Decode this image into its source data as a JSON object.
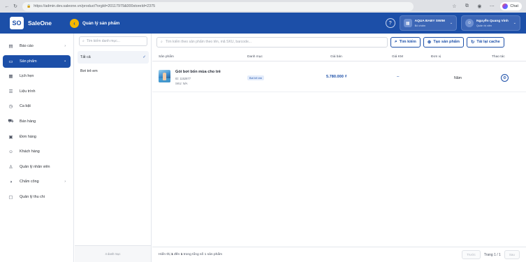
{
  "browser": {
    "url": "https://admin.dev.saleone.vn/product?orgId=20117979&000storeId=2375",
    "chat_label": "Chat"
  },
  "header": {
    "logo_mark": "SO",
    "logo_text": "SaleOne",
    "page_title": "Quản lý sản phẩm",
    "store": {
      "name": "AQUA BABY SWIM",
      "sub": "Bố chấm"
    },
    "user": {
      "name": "Nguyễn Quang Vinh",
      "role": "Quản trị viên"
    }
  },
  "sidebar": {
    "items": [
      {
        "label": "Báo cáo",
        "icon": "report-icon",
        "glyph": "▤",
        "chevron": true,
        "active": false
      },
      {
        "label": "Sản phẩm",
        "icon": "monitor-icon",
        "glyph": "▭",
        "chevron": true,
        "active": true
      },
      {
        "label": "Lịch hẹn",
        "icon": "calendar-icon",
        "glyph": "▦",
        "chevron": false,
        "active": false
      },
      {
        "label": "Liệu trình",
        "icon": "list-icon",
        "glyph": "☰",
        "chevron": false,
        "active": false
      },
      {
        "label": "Ca bật",
        "icon": "clock-icon",
        "glyph": "◷",
        "chevron": false,
        "active": false
      },
      {
        "label": "Bán hàng",
        "icon": "cart-icon",
        "glyph": "⛟",
        "chevron": false,
        "active": false
      },
      {
        "label": "Đơn hàng",
        "icon": "box-icon",
        "glyph": "▣",
        "chevron": false,
        "active": false
      },
      {
        "label": "Khách hàng",
        "icon": "users-icon",
        "glyph": "☺",
        "chevron": false,
        "active": false
      },
      {
        "label": "Quản lý nhân viên",
        "icon": "staff-icon",
        "glyph": "♙",
        "chevron": false,
        "active": false
      },
      {
        "label": "Chấm công",
        "icon": "timesheet-icon",
        "glyph": "◑",
        "chevron": true,
        "active": false
      },
      {
        "label": "Quản lý thu chi",
        "icon": "wallet-icon",
        "glyph": "▢",
        "chevron": false,
        "active": false
      }
    ]
  },
  "categories": {
    "search_placeholder": "Tìm kiếm danh mục...",
    "items": [
      {
        "label": "Tất cả",
        "active": true
      },
      {
        "label": "Bơi trẻ em",
        "active": false
      }
    ],
    "footer": "4 danh mục"
  },
  "main": {
    "search_placeholder": "Tìm kiếm theo sản phẩm theo tên, mã SKU, barcode...",
    "buttons": {
      "search": "Tìm kiếm",
      "create": "Tạo sản phẩm",
      "reload": "Tải lại cache"
    },
    "columns": {
      "product": "Sản phẩm",
      "category": "Danh mục",
      "price": "Giá bán",
      "promo": "Giá KM",
      "unit": "Đơn vị",
      "actions": "Thao tác"
    },
    "rows": [
      {
        "name": "Gói bơi bốn mùa cho trẻ",
        "id_text": "ID: 1152877",
        "sku_text": "SKU: N/A",
        "category": "Bơi trẻ em",
        "price": "5.780.000 ₫",
        "promo": "–",
        "unit": "Năm"
      }
    ],
    "pager": {
      "info_prefix": "Hiển thị",
      "from": "1",
      "mid": "đến",
      "to": "1",
      "suffix": "trong tổng số 1 sản phẩm",
      "prev": "Trước",
      "page_label": "Trang 1 / 1",
      "next": "Sau"
    }
  },
  "colors": {
    "brand": "#1c4fa8",
    "accent": "#f5b800"
  }
}
